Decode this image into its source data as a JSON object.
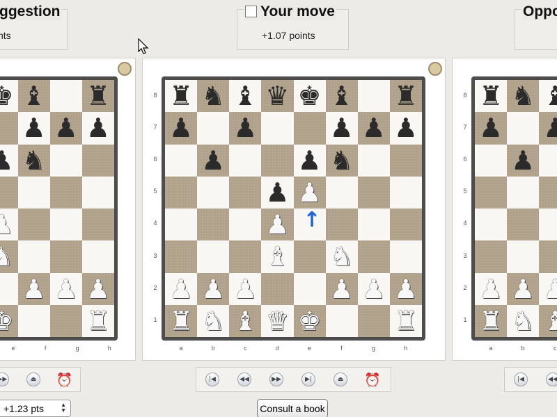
{
  "panels": {
    "left": {
      "title": "ggestion",
      "value": "nts",
      "files": [
        "e",
        "f",
        "g",
        "h"
      ],
      "visible_rows": [
        [
          "bk",
          "bb",
          "",
          "br"
        ],
        [
          "",
          "bp",
          "bp",
          "bp"
        ],
        [
          "bp",
          "bn",
          "",
          ""
        ],
        [
          "",
          "",
          "",
          ""
        ],
        [
          "wp",
          "",
          "",
          ""
        ],
        [
          "wn",
          "",
          "",
          ""
        ],
        [
          "",
          "wp",
          "wp",
          "wp"
        ],
        [
          "wk",
          "",
          "",
          "wr"
        ]
      ]
    },
    "center": {
      "title": "Your move",
      "value": "+1.07 points",
      "files": [
        "a",
        "b",
        "c",
        "d",
        "e",
        "f",
        "g",
        "h"
      ],
      "ranks": [
        "8",
        "7",
        "6",
        "5",
        "4",
        "3",
        "2",
        "1"
      ],
      "rows": [
        [
          "br",
          "bn",
          "bb",
          "bq",
          "bk",
          "bb",
          "",
          "br"
        ],
        [
          "bp",
          "",
          "bp",
          "",
          "",
          "bp",
          "bp",
          "bp"
        ],
        [
          "",
          "bp",
          "",
          "",
          "bp",
          "bn",
          "",
          ""
        ],
        [
          "",
          "",
          "",
          "bp",
          "wp",
          "",
          "",
          ""
        ],
        [
          "",
          "",
          "",
          "wp",
          "",
          "",
          "",
          ""
        ],
        [
          "",
          "",
          "",
          "wb",
          "",
          "wn",
          "",
          ""
        ],
        [
          "wp",
          "wp",
          "wp",
          "",
          "",
          "wp",
          "wp",
          "wp"
        ],
        [
          "wr",
          "wn",
          "wb",
          "wq",
          "wk",
          "",
          "",
          "wr"
        ]
      ],
      "last_move_arrow": "up-arrow"
    },
    "right": {
      "title": "Oppo",
      "files": [
        "a",
        "b",
        "c"
      ],
      "ranks": [
        "8",
        "7",
        "6",
        "5",
        "4",
        "3",
        "2",
        "1"
      ],
      "visible_rows": [
        [
          "br",
          "bn",
          "bb"
        ],
        [
          "bp",
          "",
          "bp"
        ],
        [
          "",
          "bp",
          ""
        ],
        [
          "",
          "",
          ""
        ],
        [
          "",
          "",
          ""
        ],
        [
          "",
          "",
          ""
        ],
        [
          "wp",
          "wp",
          "wp"
        ],
        [
          "wr",
          "wn",
          "wb"
        ]
      ]
    }
  },
  "icons": {
    "first": "skip-to-start-icon",
    "prev": "step-back-icon",
    "next": "step-forward-icon",
    "last": "skip-to-end-icon",
    "eject": "eject-icon",
    "clock": "alarm-clock-icon"
  },
  "points_select_value": "+1.23 pts",
  "consult_book_label": "Consult a book",
  "colors": {
    "dark_square": "#b3a58e",
    "light_square": "#f8f7f4",
    "board_frame": "#4d4d4d",
    "arrow": "#1e63d8"
  }
}
